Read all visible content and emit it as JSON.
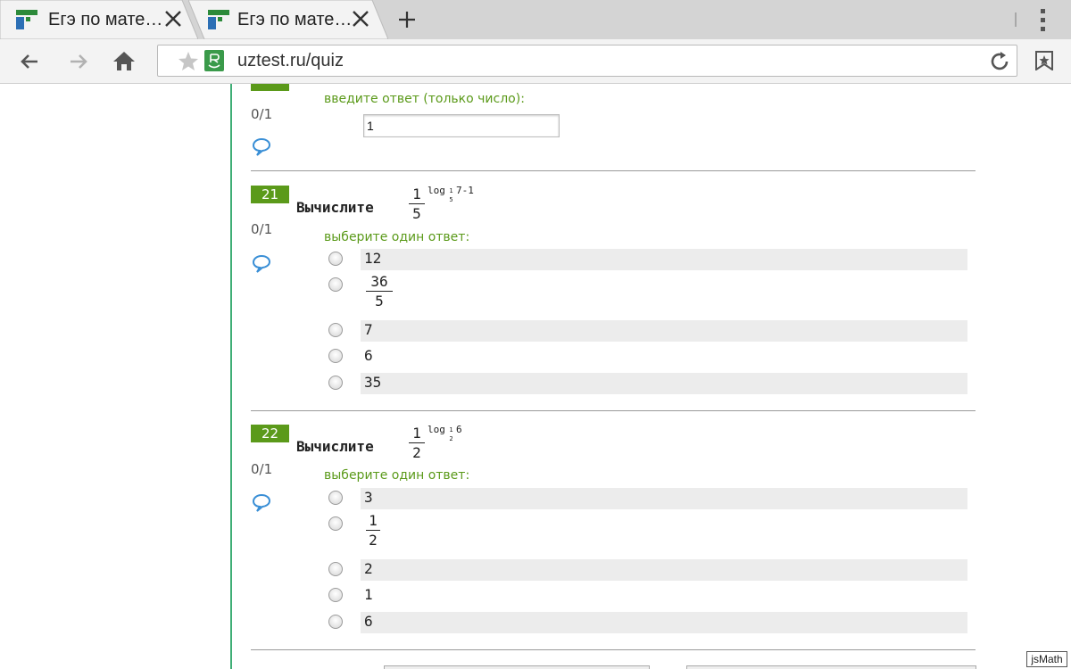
{
  "browser": {
    "tabs": [
      {
        "title": "Егэ по мате…"
      },
      {
        "title": "Егэ по мате…"
      }
    ],
    "url": "uztest.ru/quiz"
  },
  "colors": {
    "accent_green": "#5b9a1a",
    "line_green": "#3fae76",
    "comment_blue": "#3a8fd6"
  },
  "quiz": {
    "q20": {
      "score": "0/1",
      "prompt": "введите ответ (только число):",
      "answer_value": "1"
    },
    "q21": {
      "number": "21",
      "text": "Вычислите",
      "expr": {
        "num": "1",
        "den": "5",
        "exp": "log",
        "exp_tail": "7-1",
        "base_num": "1",
        "base_den": "5"
      },
      "score": "0/1",
      "prompt": "выберите один ответ:",
      "options": [
        "12",
        "36",
        "5",
        "7",
        "6",
        "35"
      ]
    },
    "q22": {
      "number": "22",
      "text": "Вычислите",
      "expr": {
        "num": "1",
        "den": "2",
        "exp": "log",
        "exp_tail": "6",
        "base_num": "1",
        "base_den": "2"
      },
      "score": "0/1",
      "prompt": "выберите один ответ:",
      "options": [
        "3",
        "1",
        "2",
        "2",
        "1",
        "6"
      ]
    }
  },
  "footer": {
    "jsmath": "jsMath"
  }
}
